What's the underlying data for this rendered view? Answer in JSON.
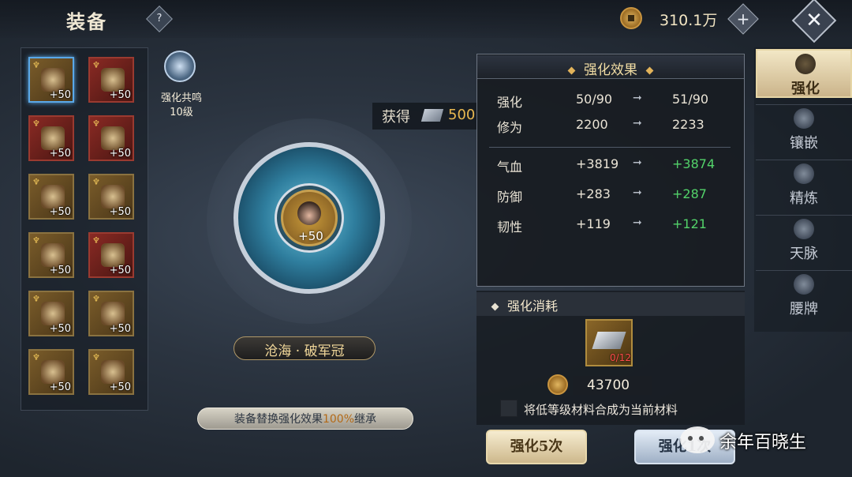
{
  "header": {
    "title": "装备",
    "help_label": "?",
    "coins": "310.1万",
    "add_label": "+",
    "close_label": "✕"
  },
  "equipment_slots": [
    {
      "level": "+50",
      "rarity": "gold",
      "selected": true
    },
    {
      "level": "+50",
      "rarity": "red",
      "selected": false
    },
    {
      "level": "+50",
      "rarity": "red",
      "selected": false
    },
    {
      "level": "+50",
      "rarity": "red",
      "selected": false
    },
    {
      "level": "+50",
      "rarity": "gold",
      "selected": false
    },
    {
      "level": "+50",
      "rarity": "gold",
      "selected": false
    },
    {
      "level": "+50",
      "rarity": "gold",
      "selected": false
    },
    {
      "level": "+50",
      "rarity": "red",
      "selected": false
    },
    {
      "level": "+50",
      "rarity": "gold",
      "selected": false
    },
    {
      "level": "+50",
      "rarity": "gold",
      "selected": false
    },
    {
      "level": "+50",
      "rarity": "gold",
      "selected": false
    },
    {
      "level": "+50",
      "rarity": "gold",
      "selected": false
    }
  ],
  "resonance": {
    "title": "强化共鸣",
    "level": "10级"
  },
  "gain": {
    "label": "获得",
    "value": "500"
  },
  "center_item": {
    "level": "+50",
    "name": "沧海 · 破军冠"
  },
  "inherit_note": {
    "prefix": "装备替换强化效果",
    "highlight": "100%",
    "suffix": "继承"
  },
  "effects": {
    "title": "强化效果",
    "rows": [
      {
        "name": "强化",
        "current": "50/90",
        "next": "51/90",
        "highlight": false
      },
      {
        "name": "修为",
        "current": "2200",
        "next": "2233",
        "highlight": false
      },
      {
        "name": "气血",
        "current": "+3819",
        "next": "+3874",
        "highlight": true
      },
      {
        "name": "防御",
        "current": "+283",
        "next": "+287",
        "highlight": true
      },
      {
        "name": "韧性",
        "current": "+119",
        "next": "+121",
        "highlight": true
      }
    ]
  },
  "cost": {
    "title": "强化消耗",
    "material_count": "0/12",
    "coin_amount": "43700",
    "merge_label": "将低等级材料合成为当前材料"
  },
  "buttons": {
    "enhance5": "强化5次",
    "enhance1": "强化1次"
  },
  "tabs": [
    {
      "label": "强化",
      "active": true
    },
    {
      "label": "镶嵌",
      "active": false
    },
    {
      "label": "精炼",
      "active": false
    },
    {
      "label": "天脉",
      "active": false
    },
    {
      "label": "腰牌",
      "active": false
    }
  ],
  "watermark": "余年百晓生",
  "colors": {
    "green_stat": "#53d36a",
    "gold_text": "#e9b850",
    "insufficient_red": "#ff4a4a"
  }
}
